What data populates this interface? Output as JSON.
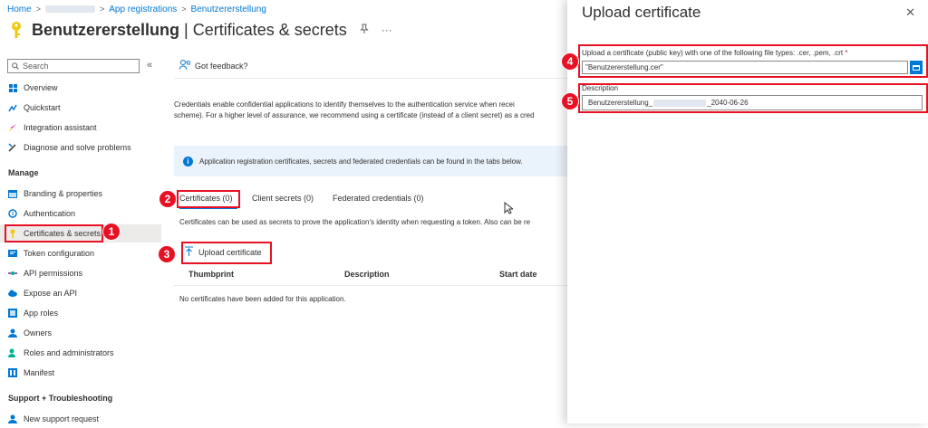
{
  "breadcrumb": {
    "home": "Home",
    "app_registrations": "App registrations",
    "current": "Benutzererstellung",
    "separator": ">"
  },
  "header": {
    "app_name": "Benutzererstellung",
    "divider": "|",
    "section": "Certificates & secrets",
    "pin_icon": "pin-icon",
    "more": "···"
  },
  "sidebar": {
    "search_placeholder": "Search",
    "collapse": "«",
    "top_items": [
      {
        "label": "Overview",
        "icon": "overview-icon"
      },
      {
        "label": "Quickstart",
        "icon": "quickstart-icon"
      },
      {
        "label": "Integration assistant",
        "icon": "rocket-icon"
      },
      {
        "label": "Diagnose and solve problems",
        "icon": "wrench-icon"
      }
    ],
    "manage_header": "Manage",
    "manage_items": [
      {
        "label": "Branding & properties",
        "icon": "branding-icon"
      },
      {
        "label": "Authentication",
        "icon": "authentication-icon"
      },
      {
        "label": "Certificates & secrets",
        "icon": "key-icon"
      },
      {
        "label": "Token configuration",
        "icon": "token-icon"
      },
      {
        "label": "API permissions",
        "icon": "api-permissions-icon"
      },
      {
        "label": "Expose an API",
        "icon": "cloud-icon"
      },
      {
        "label": "App roles",
        "icon": "app-roles-icon"
      },
      {
        "label": "Owners",
        "icon": "owners-icon"
      },
      {
        "label": "Roles and administrators",
        "icon": "roles-icon"
      },
      {
        "label": "Manifest",
        "icon": "manifest-icon"
      }
    ],
    "support_header": "Support + Troubleshooting",
    "support_items": [
      {
        "label": "New support request",
        "icon": "support-icon"
      }
    ]
  },
  "main": {
    "feedback": "Got feedback?",
    "description_line1": "Credentials enable confidential applications to identify themselves to the authentication service when recei",
    "description_line2": "scheme). For a higher level of assurance, we recommend using a certificate (instead of a client secret) as a cred",
    "info": "Application registration certificates, secrets and federated credentials can be found in the tabs below.",
    "tabs": [
      {
        "label": "Certificates (0)"
      },
      {
        "label": "Client secrets (0)"
      },
      {
        "label": "Federated credentials (0)"
      }
    ],
    "tab_description": "Certificates can be used as secrets to prove the application's identity when requesting a token. Also can be re",
    "upload_button": "Upload certificate",
    "columns": [
      "Thumbprint",
      "Description",
      "Start date"
    ],
    "empty_message": "No certificates have been added for this application."
  },
  "panel": {
    "title": "Upload certificate",
    "close": "✕",
    "file_label": "Upload a certificate (public key) with one of the following file types: .cer, .pem, .crt",
    "required_marker": "*",
    "file_value": "\"Benutzererstellung.cer\"",
    "description_label": "Description",
    "description_prefix": "Benutzererstellung_",
    "description_suffix": "_2040-06-26"
  },
  "annotations": [
    "1",
    "2",
    "3",
    "4",
    "5"
  ],
  "colors": {
    "accent": "#0078d4",
    "annotation": "#e81123",
    "info_bg": "#eaf2fb",
    "active_nav": "#edebe9"
  }
}
